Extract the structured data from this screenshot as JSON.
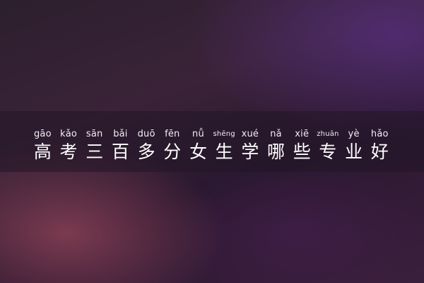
{
  "title": {
    "chars": [
      {
        "pinyin": "gāo",
        "hanzi": "高"
      },
      {
        "pinyin": "kǎo",
        "hanzi": "考"
      },
      {
        "pinyin": "sān",
        "hanzi": "三"
      },
      {
        "pinyin": "bǎi",
        "hanzi": "百"
      },
      {
        "pinyin": "duō",
        "hanzi": "多"
      },
      {
        "pinyin": "fēn",
        "hanzi": "分"
      },
      {
        "pinyin": "nǚ",
        "hanzi": "女"
      },
      {
        "pinyin": "shēng",
        "hanzi": "生"
      },
      {
        "pinyin": "xué",
        "hanzi": "学"
      },
      {
        "pinyin": "nǎ",
        "hanzi": "哪"
      },
      {
        "pinyin": "xiē",
        "hanzi": "些"
      },
      {
        "pinyin": "zhuān",
        "hanzi": "专"
      },
      {
        "pinyin": "yè",
        "hanzi": "业"
      },
      {
        "pinyin": "hǎo",
        "hanzi": "好"
      }
    ]
  }
}
